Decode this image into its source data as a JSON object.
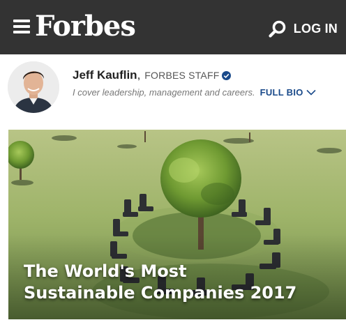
{
  "header": {
    "logo": "Forbes",
    "login_label": "LOG IN",
    "icons": [
      "hamburger-menu-icon",
      "search-icon"
    ]
  },
  "author": {
    "name": "Jeff Kauflin",
    "separator": ",",
    "role": "FORBES STAFF",
    "bio": "I cover leadership, management and careers.",
    "full_bio_label": "FULL BIO",
    "icons": [
      "verified-icon",
      "chevron-down-icon"
    ]
  },
  "hero": {
    "title_line1": "The World's Most",
    "title_line2": "Sustainable Companies 2017"
  },
  "colors": {
    "header_bg": "#333333",
    "link": "#1a4a8a",
    "verified": "#1a4a8a"
  }
}
